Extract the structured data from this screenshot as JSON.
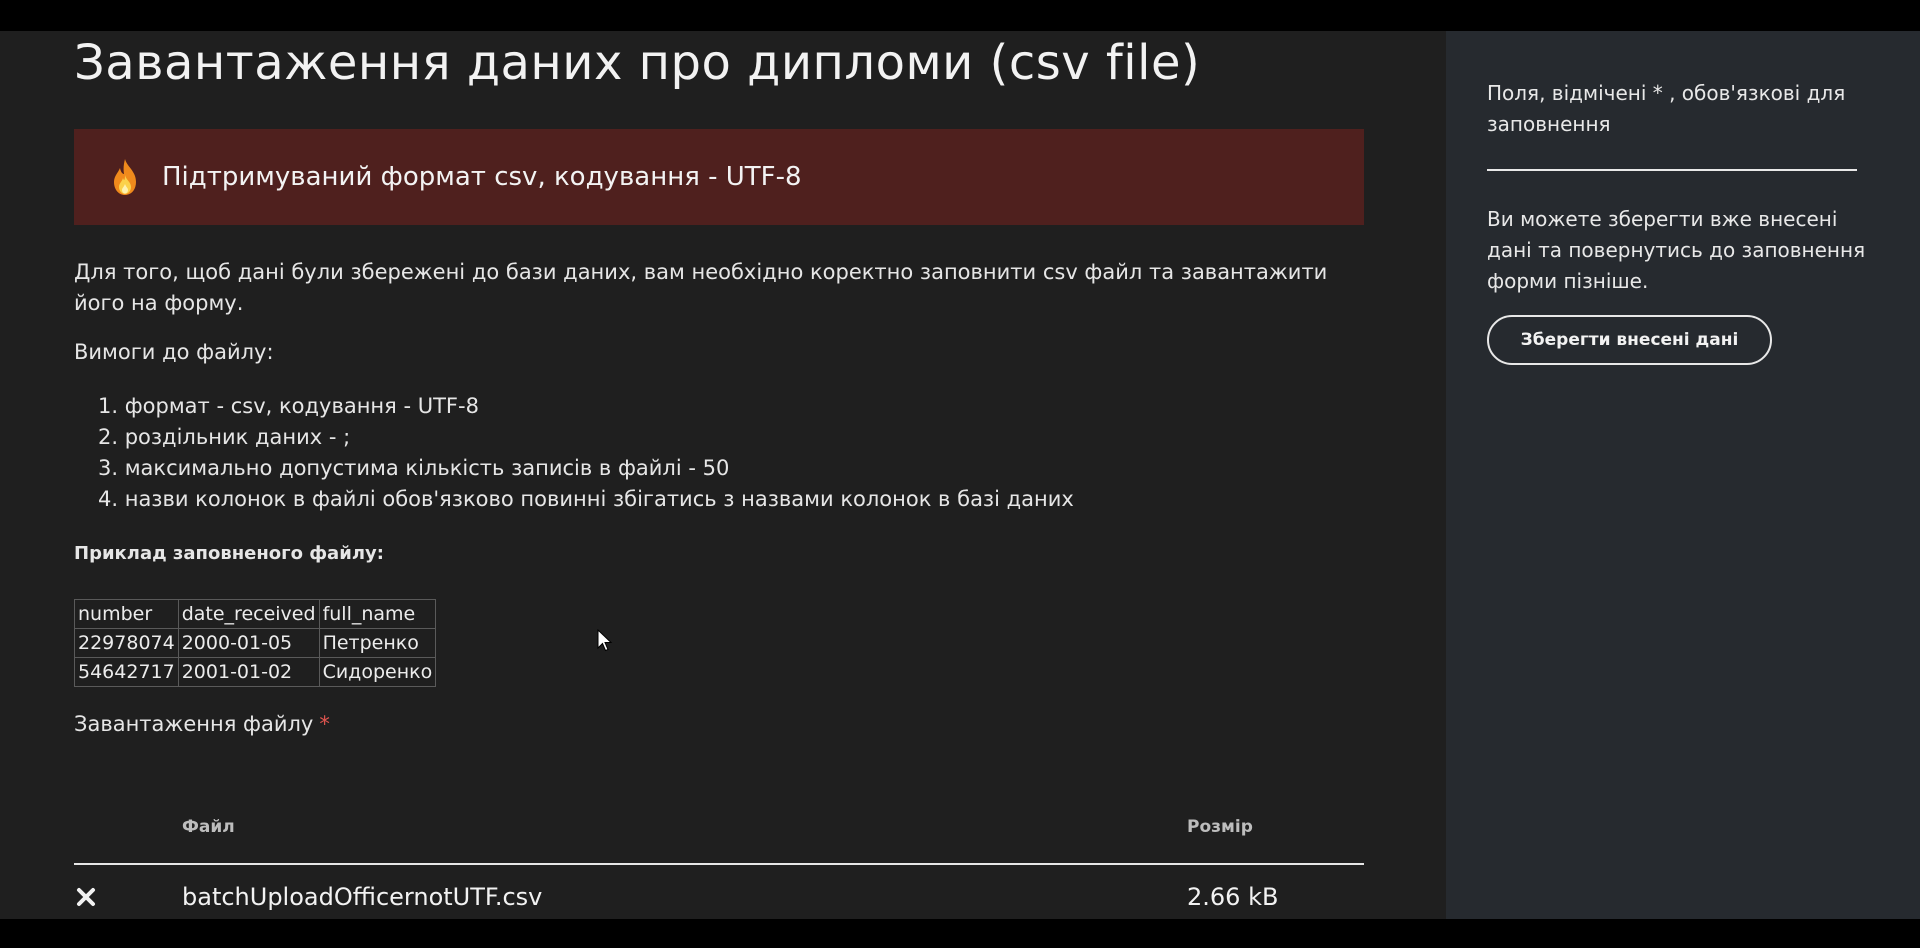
{
  "page": {
    "title": "Завантаження даних про дипломи (csv file)"
  },
  "alert": {
    "icon": "fire-icon",
    "text": "Підтримуваний формат csv, кодування - UTF-8"
  },
  "intro": "Для того, щоб дані були збережені до бази даних, вам необхідно коректно заповнити csv файл та завантажити його на форму.",
  "requirements": {
    "heading": "Вимоги до файлу:",
    "items": [
      "1. формат - csv, кодування - UTF-8",
      "2. роздільник даних - ;",
      "3. максимально допустима кількість записів в файлі - 50",
      "4. назви колонок в файлі обов'язково повинні збігатись з назвами колонок в базі даних"
    ]
  },
  "example": {
    "heading": "Приклад заповненого файлу:",
    "columns": [
      "number",
      "date_received",
      "full_name"
    ],
    "rows": [
      [
        "22978074",
        "2000-01-05",
        "Петренко"
      ],
      [
        "54642717",
        "2001-01-02",
        "Сидоренко"
      ]
    ]
  },
  "upload": {
    "label": "Завантаження файлу",
    "required_mark": "*",
    "columns": {
      "file": "Файл",
      "size": "Розмір"
    },
    "files": [
      {
        "name": "batchUploadOfficernotUTF.csv",
        "size": "2.66 kB",
        "remove_icon": "close-icon"
      }
    ]
  },
  "sidebar": {
    "required_note": "Поля, відмічені * , обов'язкові для заповнення",
    "save_note": "Ви можете зберегти вже внесені дані та повернутись до заповнення форми пізніше.",
    "save_button": "Зберегти внесені дані"
  },
  "colors": {
    "background": "#1f1f1f",
    "sidebar": "#262a2f",
    "alert": "#4f201e",
    "required": "#e0554f"
  }
}
